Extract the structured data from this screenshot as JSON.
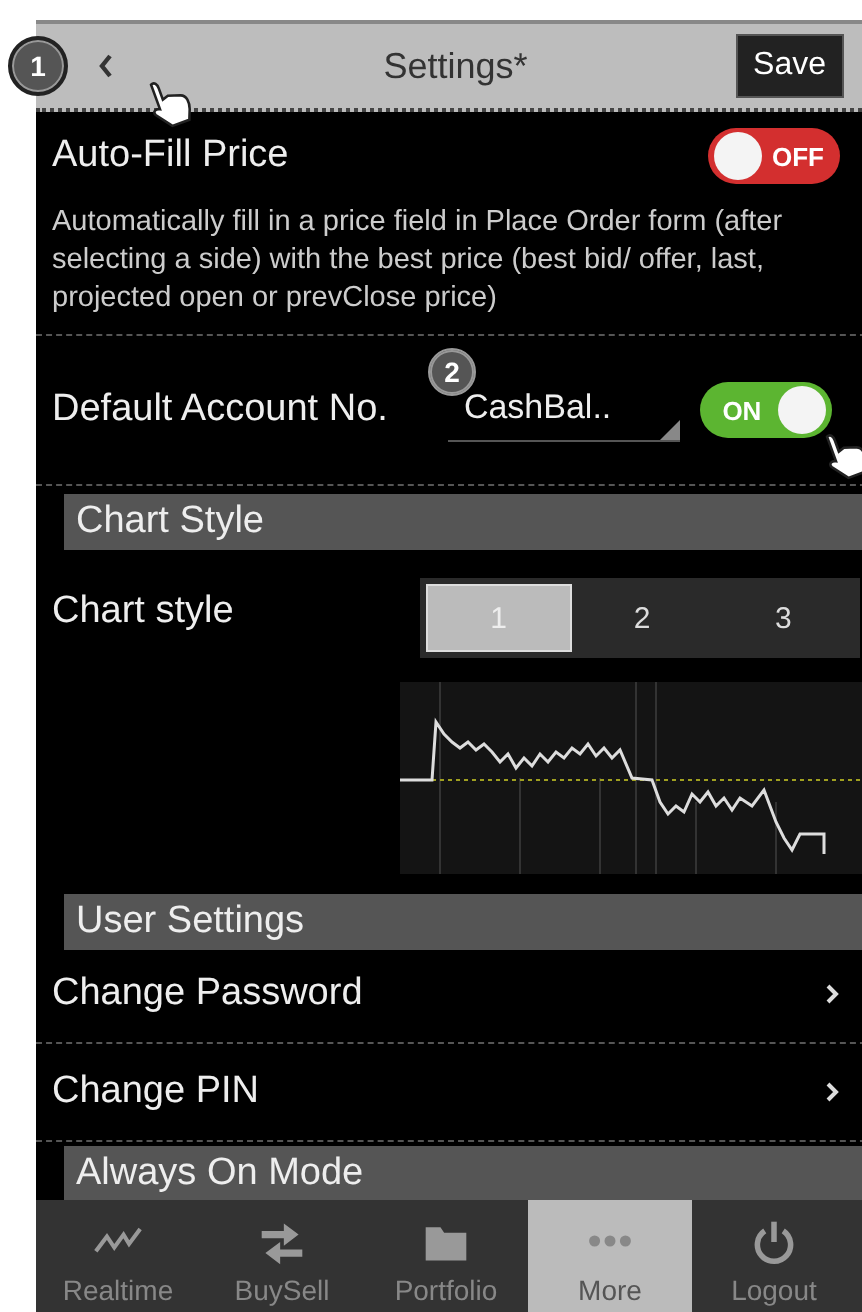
{
  "header": {
    "title": "Settings*",
    "save": "Save",
    "step_badge": "1"
  },
  "auto_fill": {
    "label": "Auto-Fill Price",
    "on": false,
    "switch_text": "OFF",
    "description": "Automatically fill in a price field in Place Order form (after selecting a side) with the best price (best bid/ offer, last, projected open or prevClose price)"
  },
  "default_account": {
    "label": "Default Account No.",
    "step_badge": "2",
    "value": "CashBal..",
    "on": true,
    "switch_text": "ON"
  },
  "chart_section": {
    "title": "Chart Style",
    "label": "Chart style",
    "options": [
      {
        "label": "1",
        "selected": true
      },
      {
        "label": "2",
        "selected": false
      },
      {
        "label": "3",
        "selected": false
      }
    ]
  },
  "user_section": {
    "title": "User Settings",
    "items": [
      {
        "label": "Change Password"
      },
      {
        "label": "Change PIN"
      }
    ]
  },
  "next_section": {
    "title": "Always On Mode"
  },
  "nav": [
    {
      "label": "Realtime",
      "kind": "chart",
      "selected": false
    },
    {
      "label": "BuySell",
      "kind": "swap",
      "selected": false
    },
    {
      "label": "Portfolio",
      "kind": "folder",
      "selected": false
    },
    {
      "label": "More",
      "kind": "dots",
      "selected": true
    },
    {
      "label": "Logout",
      "kind": "power",
      "selected": false
    }
  ]
}
